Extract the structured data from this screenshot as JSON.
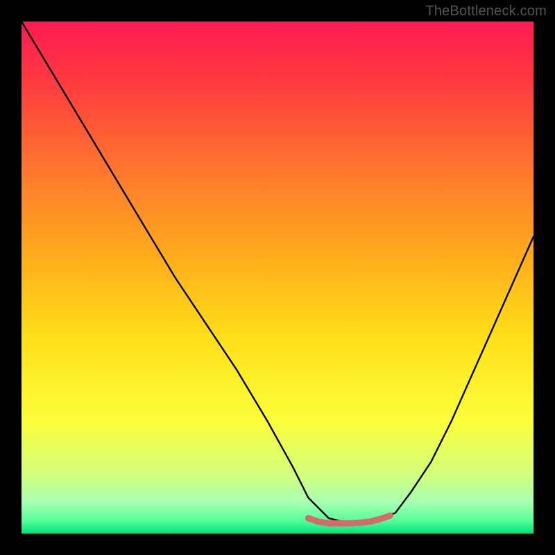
{
  "watermark": "TheBottleneck.com",
  "chart_data": {
    "type": "line",
    "title": "",
    "xlabel": "",
    "ylabel": "",
    "xlim": [
      0,
      100
    ],
    "ylim": [
      0,
      100
    ],
    "grid": false,
    "legend": false,
    "gradient_stops": [
      {
        "pos": 0.0,
        "color": "#ff1a52"
      },
      {
        "pos": 0.12,
        "color": "#ff3b3f"
      },
      {
        "pos": 0.3,
        "color": "#ff7a2d"
      },
      {
        "pos": 0.48,
        "color": "#ffb31a"
      },
      {
        "pos": 0.62,
        "color": "#ffe01a"
      },
      {
        "pos": 0.78,
        "color": "#fbff3a"
      },
      {
        "pos": 0.88,
        "color": "#d6ff7a"
      },
      {
        "pos": 0.94,
        "color": "#a6ffb3"
      },
      {
        "pos": 0.975,
        "color": "#55ff99"
      },
      {
        "pos": 1.0,
        "color": "#00e27a"
      }
    ],
    "series": [
      {
        "name": "bottleneck-curve",
        "color": "#000000",
        "x": [
          0,
          6,
          12,
          18,
          24,
          30,
          36,
          42,
          48,
          53,
          56,
          60,
          64,
          68,
          70,
          73,
          76,
          80,
          84,
          88,
          92,
          96,
          100
        ],
        "values": [
          100,
          90,
          80,
          70,
          60,
          50,
          41,
          32,
          22,
          13,
          7,
          3,
          2,
          2,
          3,
          4,
          8,
          14,
          22,
          31,
          40,
          49,
          58
        ]
      },
      {
        "name": "valley-marker",
        "color": "#d46a6a",
        "x": [
          56,
          58,
          60,
          62,
          64,
          66,
          68,
          70,
          72
        ],
        "values": [
          3.0,
          2.3,
          2.0,
          2.0,
          2.0,
          2.1,
          2.3,
          2.8,
          3.5
        ]
      }
    ]
  }
}
